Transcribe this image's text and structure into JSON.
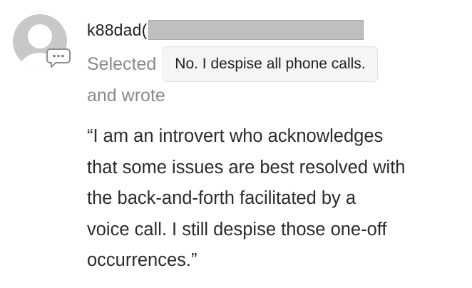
{
  "comment": {
    "username": "k88dad(",
    "selected_label": "Selected",
    "selected_answer": "No. I despise all phone calls.",
    "wrote_label": "and wrote",
    "quote_lines": [
      "“I am an introvert who acknowledges",
      "that some issues are best resolved with",
      "the back-and-forth facilitated by a",
      "voice call. I still despise those one-off",
      "occurrences.”"
    ]
  },
  "icons": {
    "avatar": "default-user-avatar-icon",
    "badge": "comment-bubble-icon"
  },
  "colors": {
    "text_primary": "#2b2b2b",
    "text_muted": "#8a8a8a",
    "chip_background": "#f4f5f7",
    "redaction": "#bfbfbf"
  }
}
